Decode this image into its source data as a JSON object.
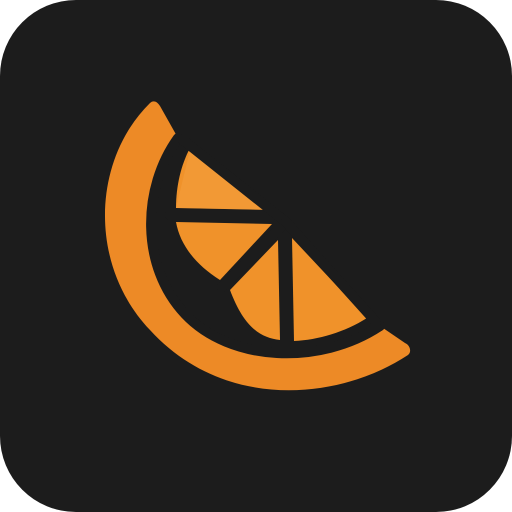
{
  "app_icon": {
    "name": "orange-slice-icon",
    "colors": {
      "background": "#1c1c1c",
      "peel": "#ed8a26",
      "segment": "#f0922a",
      "segment_highlight": "#f5a64a",
      "outline": "#1c1c1c"
    }
  }
}
